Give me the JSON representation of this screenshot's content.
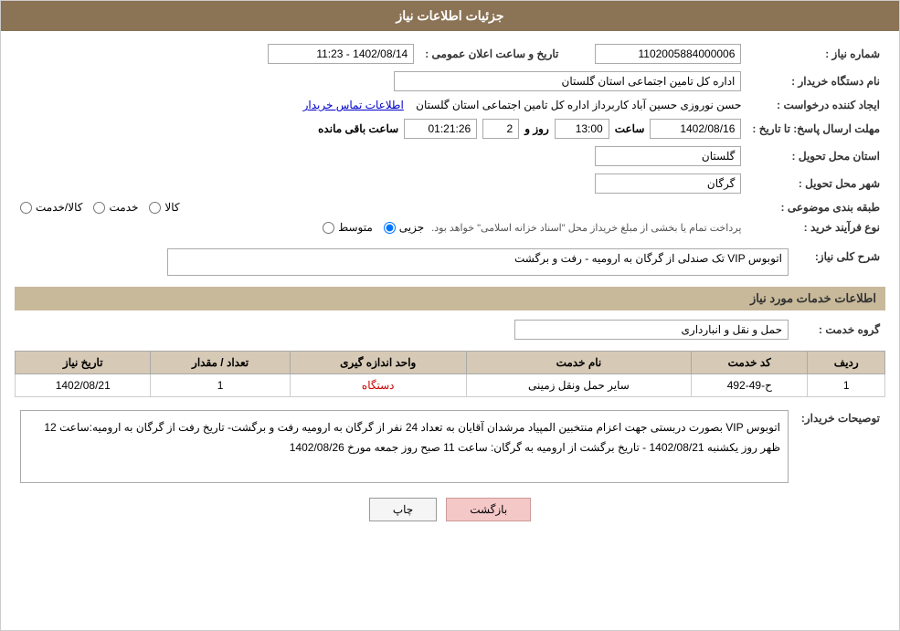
{
  "header": {
    "title": "جزئیات اطلاعات نیاز"
  },
  "fields": {
    "shomareNiaz_label": "شماره نیاز :",
    "shomareNiaz_value": "1102005884000006",
    "namDastgah_label": "نام دستگاه خریدار :",
    "namDastgah_value": "اداره کل تامین اجتماعی استان گلستان",
    "tarikhAlanOmomi_label": "تاریخ و ساعت اعلان عمومی :",
    "tarikhAlanOmomi_value": "1402/08/14 - 11:23",
    "ejadKonande_label": "ایجاد کننده درخواست :",
    "ejadKonande_value": "حسن نوروزی حسین آباد کاربرداز اداره کل تامین اجتماعی استان گلستان",
    "etelaatTamas_label": "اطلاعات تماس خریدار",
    "mohlatErsalPasokh_label": "مهلت ارسال پاسخ: تا تاریخ :",
    "date_value": "1402/08/16",
    "saat_label": "ساعت",
    "saat_value": "13:00",
    "rooz_label": "روز و",
    "rooz_value": "2",
    "saatBaghi_value": "01:21:26",
    "saatBaghiMande_label": "ساعت باقی مانده",
    "ostan_label": "استان محل تحویل :",
    "ostan_value": "گلستان",
    "shahr_label": "شهر محل تحویل :",
    "shahr_value": "گرگان",
    "tabeeBandi_label": "طبقه بندی موضوعی :",
    "radio_kala": "کالا",
    "radio_khedmat": "خدمت",
    "radio_kalaKhedmat": "کالا/خدمت",
    "noeFarayandKharid_label": "نوع فرآیند خرید :",
    "radio_jozi": "جزیی",
    "radio_mottavaset": "متوسط",
    "noeFarayand_note": "پرداخت تمام یا بخشی از مبلغ خریداز محل \"اسناد خزانه اسلامی\" خواهد بود.",
    "sharhKolliNiaz_label": "شرح کلی نیاز:",
    "sharhKolliNiaz_value": "اتوبوس VIP تک صندلی از گرگان به ارومیه - رفت و برگشت",
    "section2_title": "اطلاعات خدمات مورد نیاز",
    "goroheKhedmat_label": "گروه خدمت :",
    "goroheKhedmat_value": "حمل و نقل و انبارداری",
    "table": {
      "headers": [
        "ردیف",
        "کد خدمت",
        "نام خدمت",
        "واحد اندازه گیری",
        "تعداد / مقدار",
        "تاریخ نیاز"
      ],
      "rows": [
        {
          "radif": "1",
          "kodKhedmat": "ح-49-492",
          "namKhedmat": "سایر حمل ونقل زمینی",
          "vahed": "دستگاه",
          "tedad": "1",
          "tarikh": "1402/08/21"
        }
      ]
    },
    "description_label": "توصیحات خریدار:",
    "description_value": "اتوبوس VIP  بصورت دربستی جهت اعزام منتخبین المپیاد مرشدان آقایان به تعداد 24 نفر از گرگان به ارومیه رفت و برگشت- تاریخ رفت از گرگان به ارومیه:ساعت 12 ظهر روز یکشنبه 1402/08/21  -  تاریخ برگشت از ارومیه به گرگان: ساعت 11 صبح روز جمعه مورخ 1402/08/26"
  },
  "buttons": {
    "print": "چاپ",
    "back": "بازگشت"
  }
}
